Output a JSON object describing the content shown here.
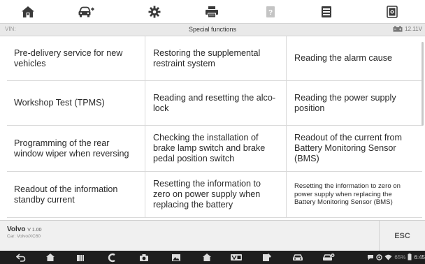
{
  "toolbar": {
    "buttons": [
      {
        "name": "home-icon",
        "title": "Home"
      },
      {
        "name": "vehicle-swap-icon",
        "title": "Vehicle"
      },
      {
        "name": "settings-icon",
        "title": "Settings"
      },
      {
        "name": "print-icon",
        "title": "Print"
      },
      {
        "name": "help-icon",
        "title": "Help"
      },
      {
        "name": "data-log-icon",
        "title": "Data Logging"
      },
      {
        "name": "screenshot-icon",
        "title": "Screenshot"
      }
    ]
  },
  "status": {
    "vin_label": "VIN:",
    "title": "Special functions",
    "battery_voltage": "12.11V"
  },
  "functions": [
    "Pre-delivery service for new vehicles",
    "Restoring the supplemental restraint system",
    "Reading the alarm cause",
    "Workshop Test (TPMS)",
    "Reading and resetting the alco-lock",
    "Reading the power supply position",
    "Programming of the rear window wiper when reversing",
    "Checking the installation of brake lamp switch and brake pedal position switch",
    "Readout of the current from Battery Monitoring Sensor (BMS)",
    "Readout of the information standby current",
    "Resetting the information to zero on power supply when replacing the battery",
    "Resetting the information to zero on power supply when replacing the Battery Monitoring Sensor (BMS)"
  ],
  "vehicle": {
    "make": "Volvo",
    "version": "V 1.00",
    "car": "Car: Volvo/XC60"
  },
  "esc_label": "ESC",
  "system": {
    "battery": "65%",
    "time": "6:45"
  },
  "colors": {
    "toolbar_bg": "#ffffff",
    "status_bg": "#e9e9e9",
    "nav_bg": "#1e1e1e"
  }
}
